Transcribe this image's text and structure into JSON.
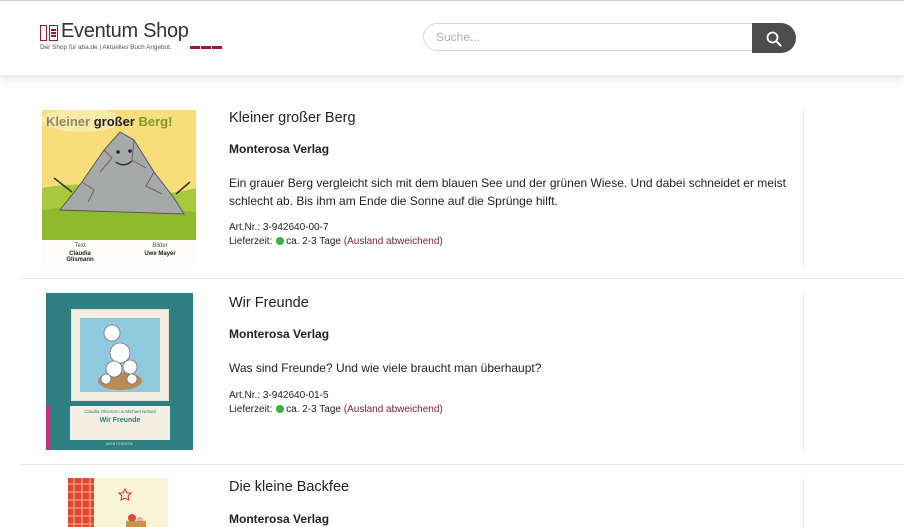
{
  "header": {
    "logo_title": "Eventum Shop",
    "logo_tagline": "Der Shop für aba.de | Aktuelles Buch Angebot.",
    "search_placeholder": "Suche...",
    "brand_color": "#9a1a2e",
    "search_icon": "magnifier-icon"
  },
  "products": [
    {
      "cover_title_1": "Kleiner ",
      "cover_title_2": "großer",
      "cover_title_3": " Berg!",
      "cover_credit_left_label": "Text",
      "cover_credit_left_name": "Claudia Glismann",
      "cover_credit_right_label": "Bilder",
      "cover_credit_right_name": "Uwe Mayer",
      "title": "Kleiner großer Berg",
      "publisher": "Monterosa Verlag",
      "description": "Ein grauer Berg vergleicht sich mit dem blauen See und der grünen Wiese. Und dabei schneidet er meist schlecht ab. Bis ihm am Ende die Sonne auf die Sprünge hilft.",
      "art_label": "Art.Nr.:",
      "art_nr": "3-942640-00-7",
      "delivery_label": "Lieferzeit:",
      "delivery_time": "ca. 2-3 Tage",
      "abroad_link": "(Ausland abweichend)",
      "delivery_status_color": "#3fae3f"
    },
    {
      "cover_authors": "Claudia Glismann & Michael Netwal",
      "cover_title": "Wir Freunde",
      "cover_publisher": "MONTEROSA",
      "title": "Wir Freunde",
      "publisher": "Monterosa Verlag",
      "description": "Was sind Freunde? Und wie viele braucht man überhaupt?",
      "art_label": "Art.Nr.:",
      "art_nr": "3-942640-01-5",
      "delivery_label": "Lieferzeit:",
      "delivery_time": "ca. 2-3 Tage",
      "abroad_link": "(Ausland abweichend)",
      "delivery_status_color": "#3fae3f"
    },
    {
      "title": "Die kleine Backfee",
      "publisher": "Monterosa Verlag"
    }
  ]
}
